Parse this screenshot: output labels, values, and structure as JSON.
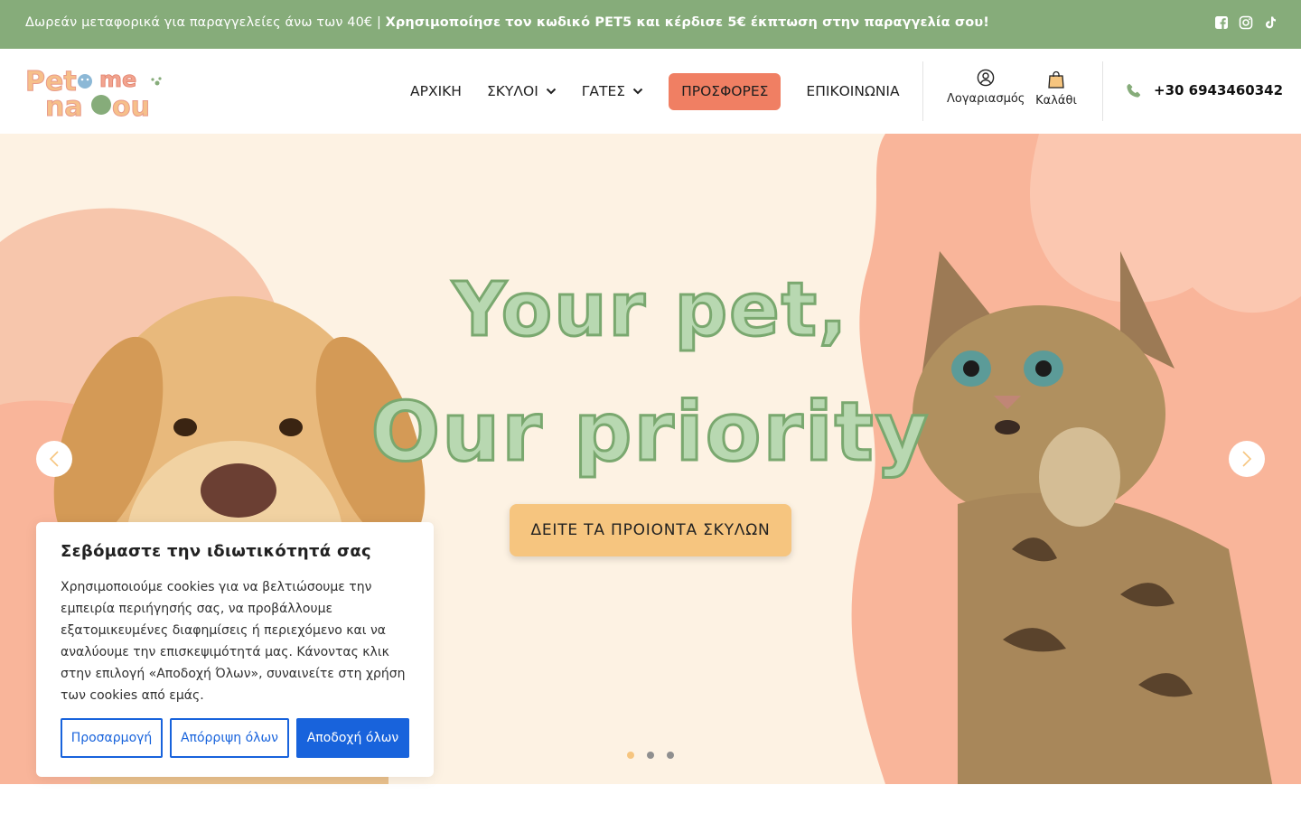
{
  "topbar": {
    "message_regular": "Δωρεάν μεταφορικά για παραγγελείες άνω των 40€ | ",
    "message_bold": "Χρησιμοποίησε τον κωδικό PET5 και κέρδισε 5€ έκπτωση στην παραγγελία σου!",
    "socials": [
      "facebook-icon",
      "instagram-icon",
      "tiktok-icon"
    ],
    "bg_color": "#86ac7a"
  },
  "header": {
    "logo_text": "Pet me na tou",
    "nav": {
      "home": "ΑΡΧΙΚΗ",
      "dogs": "ΣΚΥΛΟΙ",
      "cats": "ΓΑΤΕΣ",
      "offers": "ΠΡΟΣΦΟΡΕΣ",
      "contact": "ΕΠΙΚΟΙΝΩΝΙΑ"
    },
    "account_label": "Λογαριασμός",
    "cart_label": "Καλάθι",
    "phone": "+30 6943460342",
    "offers_color": "#f07f63"
  },
  "hero": {
    "headline_line1": "Your pet,",
    "headline_line2": "Our priority",
    "cta_label": "ΔΕΙΤΕ ΤΑ ΠΡΟΙΟΝΤΑ ΣΚΥΛΩΝ",
    "slides_total": 3,
    "active_slide": 1,
    "cta_color": "#f6c57f"
  },
  "cookie": {
    "title": "Σεβόμαστε την ιδιωτικότητά σας",
    "body": "Χρησιμοποιούμε cookies για να βελτιώσουμε την εμπειρία περιήγησής σας, να προβάλλουμε εξατομικευμένες διαφημίσεις ή περιεχόμενο και να αναλύουμε την επισκεψιμότητά μας. Κάνοντας κλικ στην επιλογή «Αποδοχή Όλων», συναινείτε στη χρήση των cookies από εμάς.",
    "customize": "Προσαρμογή",
    "reject": "Απόρριψη όλων",
    "accept": "Αποδοχή όλων",
    "accent_color": "#1863dc"
  }
}
